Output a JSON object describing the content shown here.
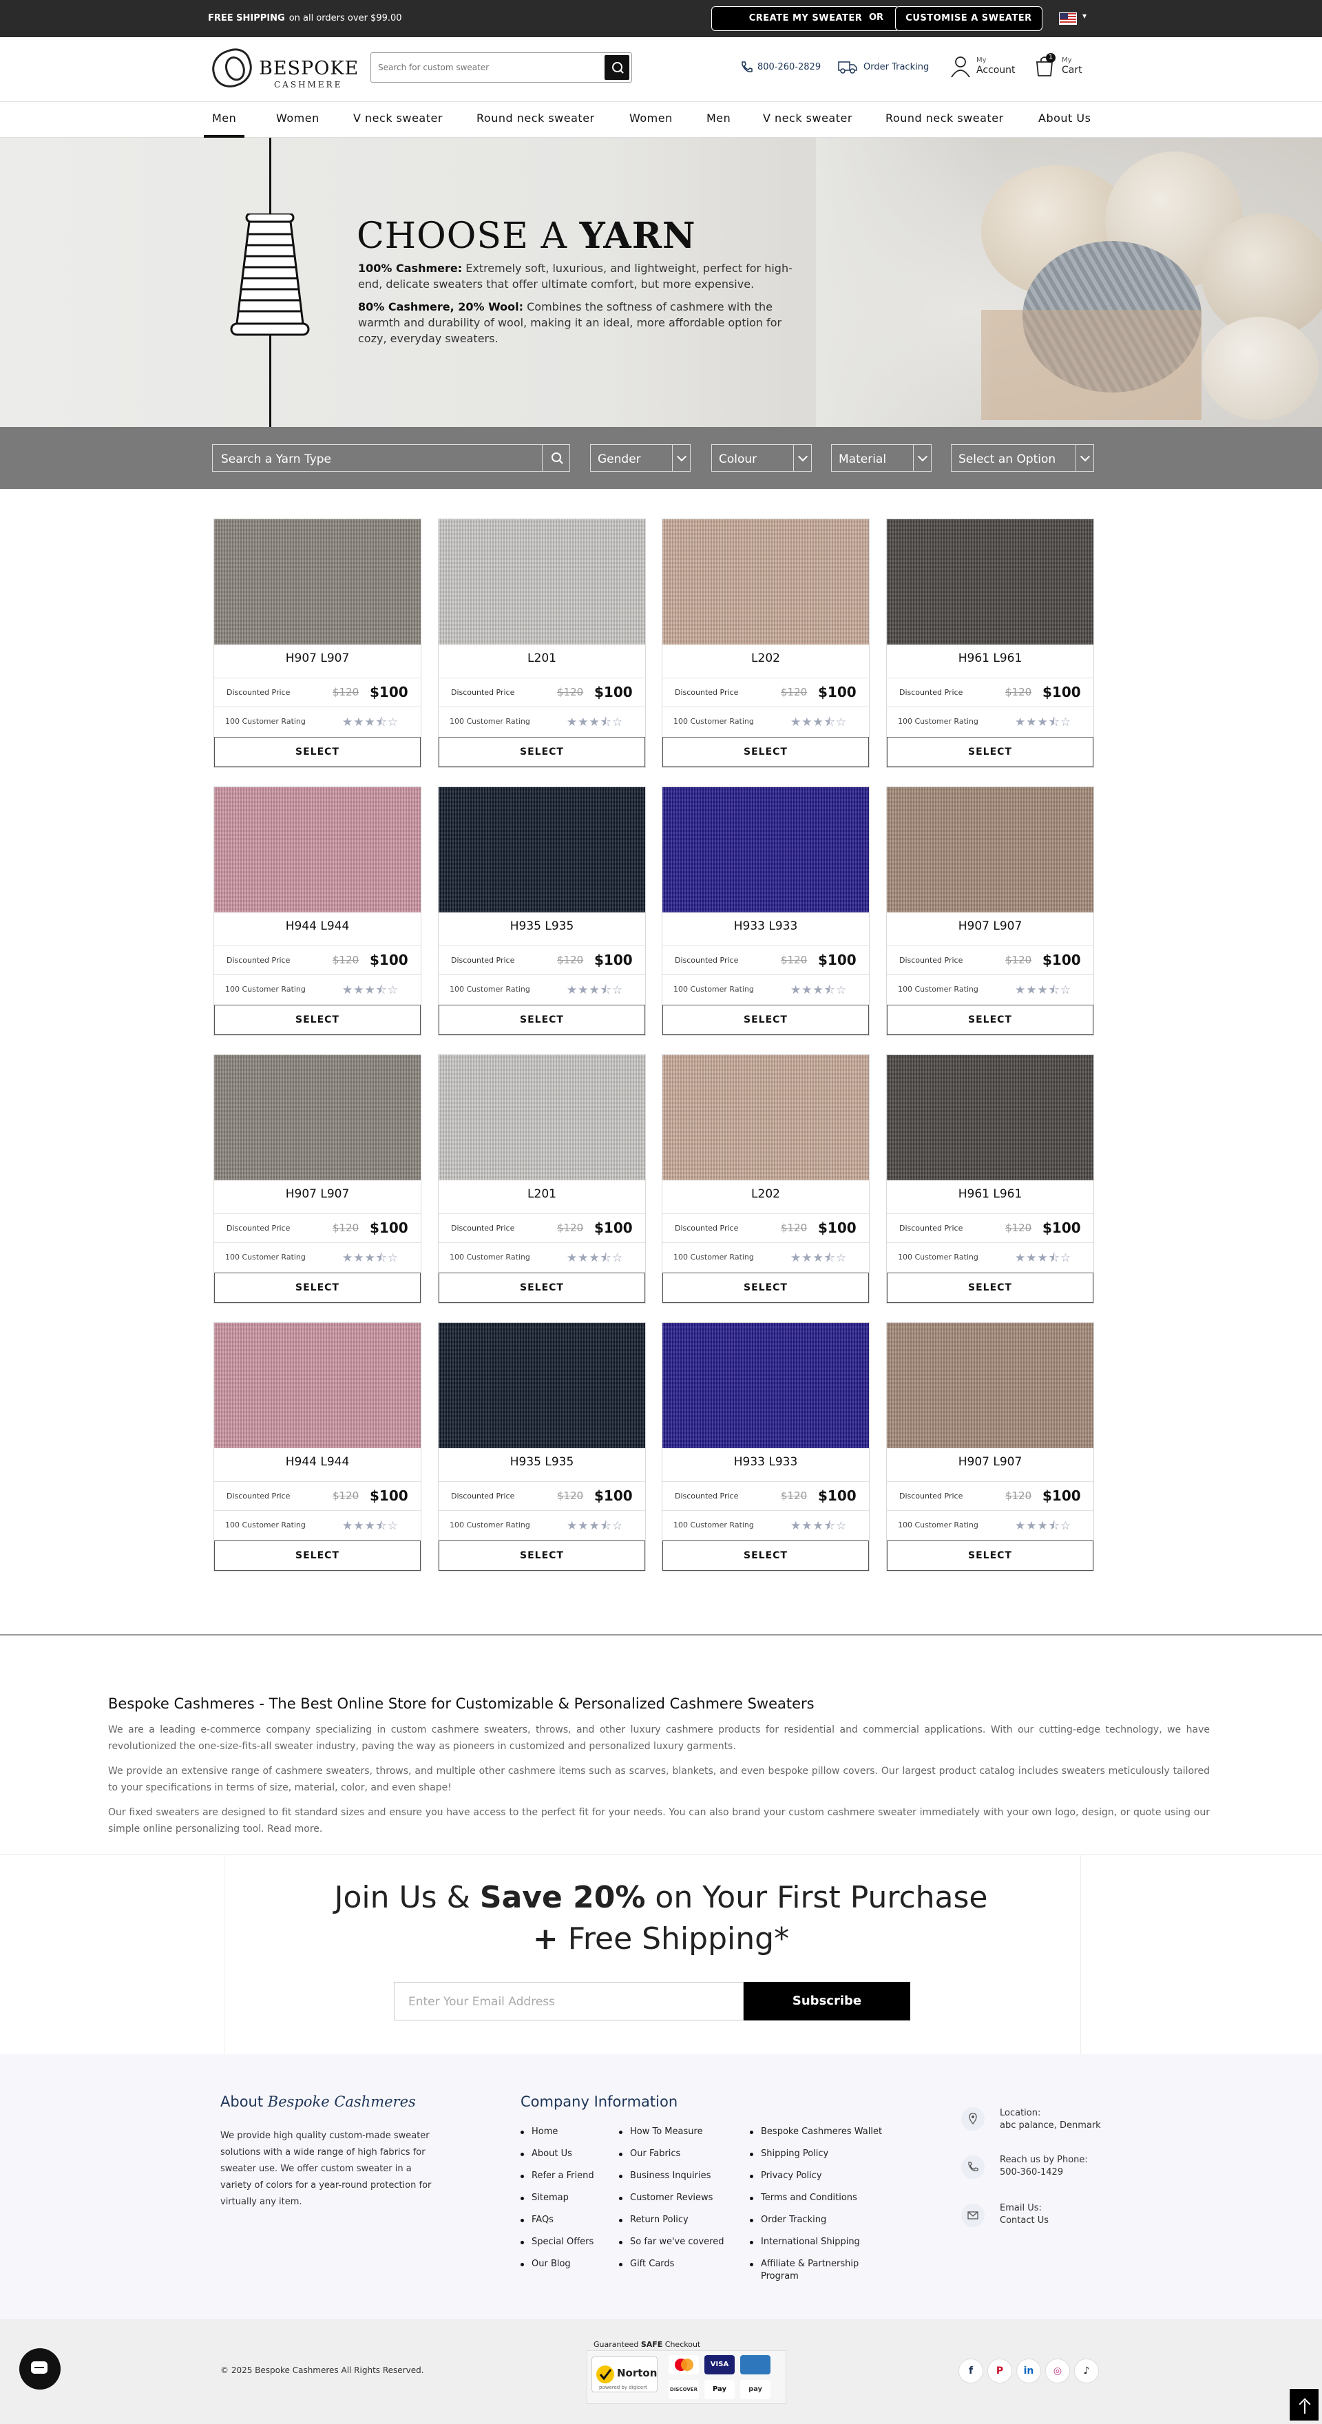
{
  "topbar": {
    "promo_bold": "FREE SHIPPING",
    "promo_rest": "on all orders over $99.00",
    "create_btn": "CREATE MY SWEATER",
    "or": "OR",
    "customise_btn": "CUSTOMISE A SWEATER"
  },
  "header": {
    "logo_main": "BESPOKE",
    "logo_sub": "CASHMERE",
    "search_placeholder": "Search for custom sweater",
    "phone": "800-260-2829",
    "order_tracking": "Order Tracking",
    "account_small": "My",
    "account_big": "Account",
    "cart_small": "My",
    "cart_big": "Cart",
    "cart_count": "1"
  },
  "nav": [
    "Men",
    "Women",
    "V neck sweater",
    "Round neck sweater",
    "Women",
    "Men",
    "V neck sweater",
    "Round neck sweater",
    "About Us"
  ],
  "hero": {
    "title_light": "CHOOSE A ",
    "title_bold": "YARN",
    "p1_bold": "100% Cashmere:",
    "p1_rest": " Extremely soft, luxurious, and lightweight, perfect for high-end, delicate sweaters that offer ultimate comfort, but more expensive.",
    "p2_bold": "80% Cashmere, 20% Wool:",
    "p2_rest": " Combines the softness of cashmere with the warmth and durability of wool, making it an ideal, more affordable option for cozy, everyday sweaters."
  },
  "filters": {
    "search_placeholder": "Search a  Yarn Type",
    "gender": "Gender",
    "colour": "Colour",
    "material": "Material",
    "option": "Select an Option"
  },
  "card_labels": {
    "discounted": "Discounted Price",
    "old_price": "$120",
    "new_price": "$100",
    "rating_label": "100 Customer Rating",
    "stars": "★★★⯪☆",
    "select": "SELECT"
  },
  "products": [
    {
      "name": "H907 L907",
      "color": "#8a857c"
    },
    {
      "name": "L201",
      "color": "#c9c8c5"
    },
    {
      "name": "L202",
      "color": "#c8aa99"
    },
    {
      "name": "H961 L961",
      "color": "#4a4644"
    },
    {
      "name": "H944 L944",
      "color": "#cc95a3"
    },
    {
      "name": "H935 L935",
      "color": "#111b2b"
    },
    {
      "name": "H933 L933",
      "color": "#241b8a"
    },
    {
      "name": "H907 L907",
      "color": "#a48a78"
    },
    {
      "name": "H907 L907",
      "color": "#8a857c"
    },
    {
      "name": "L201",
      "color": "#c9c8c5"
    },
    {
      "name": "L202",
      "color": "#c8aa99"
    },
    {
      "name": "H961 L961",
      "color": "#4a4644"
    },
    {
      "name": "H944 L944",
      "color": "#cc95a3"
    },
    {
      "name": "H935 L935",
      "color": "#111b2b"
    },
    {
      "name": "H933 L933",
      "color": "#241b8a"
    },
    {
      "name": "H907 L907",
      "color": "#a48a78"
    }
  ],
  "about": {
    "title": "Bespoke Cashmeres - The Best Online Store for Customizable & Personalized Cashmere Sweaters",
    "p1": "We are a leading e-commerce company specializing in custom cashmere sweaters, throws, and other luxury cashmere products for residential and commercial applications. With our cutting-edge technology, we have revolutionized the one-size-fits-all sweater industry, paving the way as pioneers in customized and personalized luxury garments.",
    "p2": "We provide an extensive range of cashmere sweaters, throws, and multiple other cashmere items such as scarves, blankets, and even bespoke pillow covers. Our largest product catalog includes sweaters meticulously tailored to your specifications in terms of size, material, color, and even shape!",
    "p3": "Our fixed sweaters are designed to fit standard sizes and ensure you have access to the perfect fit for your needs. You can also brand your custom cashmere sweater immediately with your own logo, design, or quote using our simple online personalizing tool. Read more."
  },
  "subscribe": {
    "line1_pre": "Join Us & ",
    "line1_bold": "Save 20%",
    "line1_post": " on Your First Purchase",
    "line2_plus": "+",
    "line2_rest": " Free Shipping*",
    "placeholder": "Enter Your Email Address",
    "button": "Subscribe"
  },
  "footer": {
    "about_title_pre": "About ",
    "about_title_em": "Bespoke Cashmeres",
    "about_text": "We provide high quality custom-made sweater solutions with a wide range of high fabrics for sweater use. We offer custom sweater in a variety of colors for a year-round protection for virtually any item.",
    "company_title": "Company Information",
    "col1": [
      "Home",
      "About Us",
      "Refer a Friend",
      "Sitemap",
      "FAQs",
      "Special Offers",
      "Our Blog"
    ],
    "col2": [
      "How To Measure",
      "Our Fabrics",
      "Business Inquiries",
      "Customer Reviews",
      "Return Policy",
      "So far we've covered",
      "Gift Cards"
    ],
    "col3": [
      "Bespoke Cashmeres Wallet",
      "Shipping Policy",
      "Privacy Policy",
      "Terms and Conditions",
      "Order Tracking",
      "International Shipping",
      "Affiliate & Partnership",
      "Program"
    ],
    "location_label": "Location:",
    "location_value": "abc palance, Denmark",
    "phone_label": "Reach us by Phone:",
    "phone_value": "500-360-1429",
    "email_label": "Email Us:",
    "email_value": "Contact Us",
    "copyright": "© 2025 Bespoke Cashmeres All Rights Reserved.",
    "safe_pre": "Guaranteed ",
    "safe_bold": "SAFE",
    "safe_post": " Checkout",
    "norton": "Norton",
    "norton_sub": "powered by digicert",
    "pay_icons": [
      "VISA",
      "DISCOVER",
      "Pay",
      "pay"
    ],
    "social": [
      "f",
      "P",
      "in",
      "◎",
      "♪"
    ]
  }
}
